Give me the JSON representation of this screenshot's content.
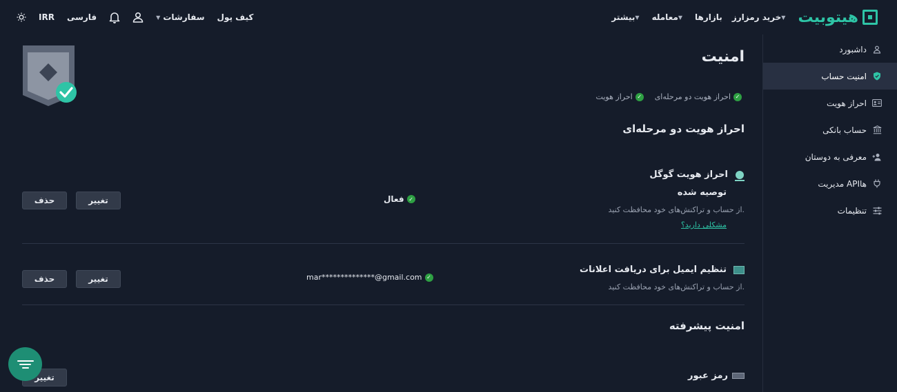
{
  "topbar": {
    "logo_text": "هیتوبیت",
    "nav": [
      {
        "label": "خرید رمزارز",
        "caret": true
      },
      {
        "label": "بازارها",
        "caret": false
      },
      {
        "label": "معامله",
        "caret": true
      },
      {
        "label": "بیشتر",
        "caret": true
      }
    ],
    "wallet_label": "کیف پول",
    "orders_label": "سفارشات",
    "language_label": "فارسی",
    "currency_label": "IRR"
  },
  "sidebar": {
    "items": [
      {
        "label": "داشبورد",
        "icon": "user-icon",
        "active": false
      },
      {
        "label": "امنیت حساب",
        "icon": "shield-icon",
        "active": true
      },
      {
        "label": "احراز هویت",
        "icon": "id-card-icon",
        "active": false
      },
      {
        "label": "حساب بانکی",
        "icon": "bank-icon",
        "active": false
      },
      {
        "label": "معرفی به دوستان",
        "icon": "add-user-icon",
        "active": false
      },
      {
        "label": "مدیریت APIها",
        "icon": "plug-icon",
        "active": false
      },
      {
        "label": "تنظیمات",
        "icon": "sliders-icon",
        "active": false
      }
    ]
  },
  "main": {
    "title": "امنیت",
    "checks": [
      "احراز هویت دو مرحله‌ای",
      "احراز هویت"
    ],
    "two_factor": {
      "section_title": "احراز هویت دو مرحله‌ای",
      "google": {
        "title": "احراز هویت گوگل",
        "recommended": "توصیه شده",
        "description": "از حساب و تراکنش‌های خود محافظت کنید.",
        "help_link": "مشکلی دارید؟",
        "status": "فعال",
        "change_label": "تغییر",
        "delete_label": "حذف"
      },
      "email": {
        "title": "تنظیم ایمیل برای دریافت اعلانات",
        "description": "از حساب و تراکنش‌های خود محافظت کنید.",
        "value": "mar**************@gmail.com",
        "change_label": "تغییر",
        "delete_label": "حذف"
      }
    },
    "advanced": {
      "section_title": "امنیت پیشرفته",
      "password_title": "رمز عبور",
      "change_label": "تغییر"
    }
  },
  "colors": {
    "background": "#151c2a",
    "accent": "#2ec4a6",
    "success": "#2ea043",
    "button": "#323a49"
  }
}
